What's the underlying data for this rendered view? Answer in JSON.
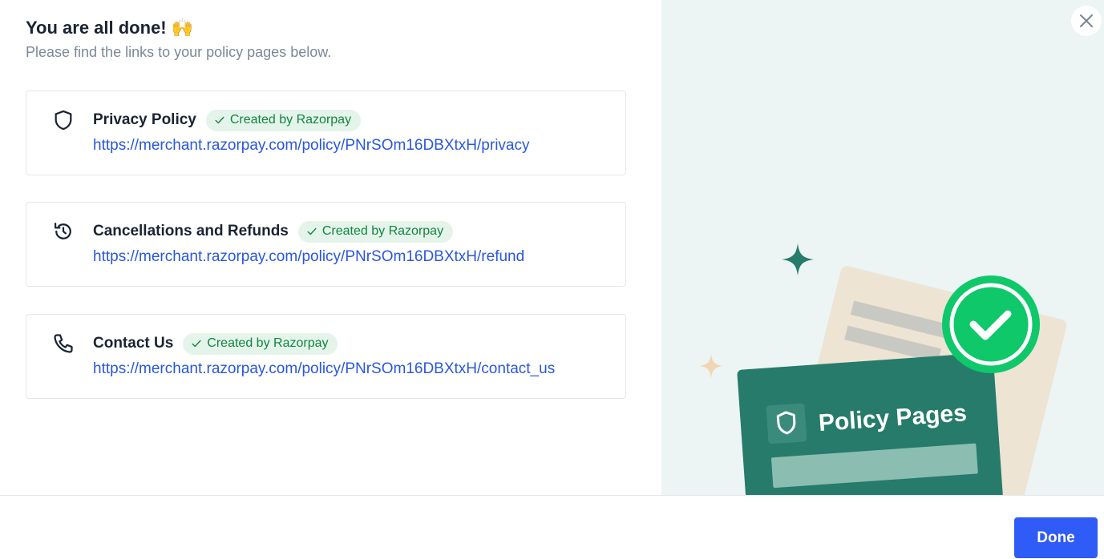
{
  "header": {
    "title": "You are all done! 🙌",
    "subtitle": "Please find the links to your policy pages below."
  },
  "policies": [
    {
      "name": "Privacy Policy",
      "icon": "shield-icon",
      "badge": "Created by Razorpay",
      "url": "https://merchant.razorpay.com/policy/PNrSOm16DBXtxH/privacy"
    },
    {
      "name": "Cancellations and Refunds",
      "icon": "refund-icon",
      "badge": "Created by Razorpay",
      "url": "https://merchant.razorpay.com/policy/PNrSOm16DBXtxH/refund"
    },
    {
      "name": "Contact Us",
      "icon": "phone-icon",
      "badge": "Created by Razorpay",
      "url": "https://merchant.razorpay.com/policy/PNrSOm16DBXtxH/contact_us"
    }
  ],
  "illustration": {
    "label": "Policy Pages"
  },
  "footer": {
    "done_label": "Done"
  },
  "colors": {
    "accent": "#2f5bf7",
    "link": "#2957dc",
    "success": "#128442",
    "badge_bg": "#e4f4ea",
    "panel_bg": "#ecf4f4",
    "card_green": "#267b6b"
  }
}
